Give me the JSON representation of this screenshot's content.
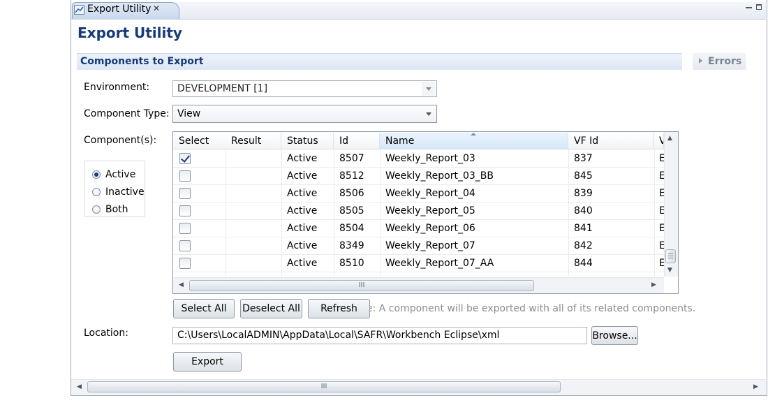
{
  "tab": {
    "title": "Export Utility",
    "close": "✕"
  },
  "page_title": "Export Utility",
  "section": {
    "title": "Components to Export",
    "errors_title": "Errors"
  },
  "environment": {
    "label": "Environment:",
    "value": "DEVELOPMENT [1]"
  },
  "component_type": {
    "label": "Component Type:",
    "value": "View"
  },
  "components": {
    "label": "Component(s):",
    "filter": {
      "options": [
        "Active",
        "Inactive",
        "Both"
      ],
      "selected": "Active"
    },
    "columns": [
      "Select",
      "Result",
      "Status",
      "Id",
      "Name",
      "VF Id",
      "V"
    ],
    "rows": [
      {
        "selected": true,
        "result": "",
        "status": "Active",
        "id": "8507",
        "name": "Weekly_Report_03",
        "vf_id": "837",
        "v": "E"
      },
      {
        "selected": false,
        "result": "",
        "status": "Active",
        "id": "8512",
        "name": "Weekly_Report_03_BB",
        "vf_id": "845",
        "v": "E"
      },
      {
        "selected": false,
        "result": "",
        "status": "Active",
        "id": "8506",
        "name": "Weekly_Report_04",
        "vf_id": "839",
        "v": "E"
      },
      {
        "selected": false,
        "result": "",
        "status": "Active",
        "id": "8505",
        "name": "Weekly_Report_05",
        "vf_id": "840",
        "v": "E"
      },
      {
        "selected": false,
        "result": "",
        "status": "Active",
        "id": "8504",
        "name": "Weekly_Report_06",
        "vf_id": "841",
        "v": "E"
      },
      {
        "selected": false,
        "result": "",
        "status": "Active",
        "id": "8349",
        "name": "Weekly_Report_07",
        "vf_id": "842",
        "v": "E"
      },
      {
        "selected": false,
        "result": "",
        "status": "Active",
        "id": "8510",
        "name": "Weekly_Report_07_AA",
        "vf_id": "844",
        "v": "E"
      }
    ],
    "sorted_column": "Name"
  },
  "buttons": {
    "select_all": "Select All",
    "deselect_all": "Deselect All",
    "refresh": "Refresh",
    "browse": "Browse...",
    "export": "Export"
  },
  "note": "e: A component will be exported with all of its related components.",
  "location": {
    "label": "Location:",
    "value": "C:\\Users\\LocalADMIN\\AppData\\Local\\SAFR\\Workbench Eclipse\\xml"
  },
  "scroll_grip": "III",
  "icons": {
    "tab_icon": "chart-icon",
    "minimize": "minimize-icon",
    "maximize": "maximize-icon"
  },
  "colors": {
    "title": "#173a78",
    "accent": "#1a3a78"
  }
}
